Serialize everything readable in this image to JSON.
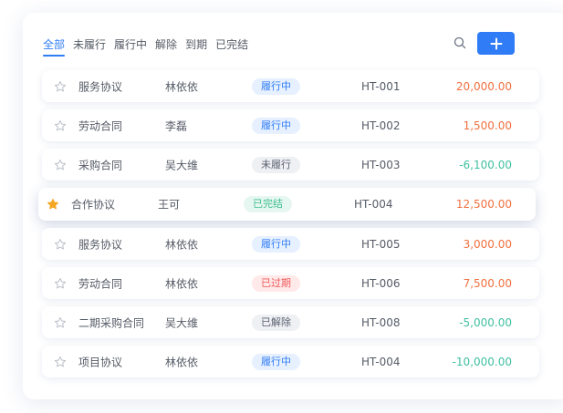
{
  "tabs": [
    {
      "label": "全部",
      "active": true
    },
    {
      "label": "未履行",
      "active": false
    },
    {
      "label": "履行中",
      "active": false
    },
    {
      "label": "解除",
      "active": false
    },
    {
      "label": "到期",
      "active": false
    },
    {
      "label": "已完结",
      "active": false
    }
  ],
  "toolbar": {
    "search_icon": "search-icon",
    "filter_icon": "filter-icon",
    "more_icon": "more-icon",
    "add_icon": "plus-icon"
  },
  "colors": {
    "accent": "#2f7cf6",
    "positive_amount": "#f0703f",
    "negative_amount": "#3fbfa1",
    "star_active": "#f5a623"
  },
  "status_styles": {
    "履行中": {
      "bg": "#e6f0ff",
      "fg": "#2f7cf6"
    },
    "未履行": {
      "bg": "#eef0f4",
      "fg": "#5a6170"
    },
    "已完结": {
      "bg": "#e6f7f1",
      "fg": "#3fbf8f"
    },
    "已过期": {
      "bg": "#ffe9e9",
      "fg": "#f05a5a"
    },
    "已解除": {
      "bg": "#eef0f4",
      "fg": "#5a6170"
    }
  },
  "rows": [
    {
      "name": "服务协议",
      "person": "林依依",
      "status": "履行中",
      "code": "HT-001",
      "amount": "20,000.00",
      "sign": "pos",
      "starred": false,
      "highlight": false
    },
    {
      "name": "劳动合同",
      "person": "李磊",
      "status": "履行中",
      "code": "HT-002",
      "amount": "1,500.00",
      "sign": "pos",
      "starred": false,
      "highlight": false
    },
    {
      "name": "采购合同",
      "person": "吴大维",
      "status": "未履行",
      "code": "HT-003",
      "amount": "-6,100.00",
      "sign": "neg",
      "starred": false,
      "highlight": false
    },
    {
      "name": "合作协议",
      "person": "王可",
      "status": "已完结",
      "code": "HT-004",
      "amount": "12,500.00",
      "sign": "pos",
      "starred": true,
      "highlight": true
    },
    {
      "name": "服务协议",
      "person": "林依依",
      "status": "履行中",
      "code": "HT-005",
      "amount": "3,000.00",
      "sign": "pos",
      "starred": false,
      "highlight": false
    },
    {
      "name": "劳动合同",
      "person": "林依依",
      "status": "已过期",
      "code": "HT-006",
      "amount": "7,500.00",
      "sign": "pos",
      "starred": false,
      "highlight": false
    },
    {
      "name": "二期采购合同",
      "person": "吴大维",
      "status": "已解除",
      "code": "HT-008",
      "amount": "-5,000.00",
      "sign": "neg",
      "starred": false,
      "highlight": false
    },
    {
      "name": "项目协议",
      "person": "林依依",
      "status": "履行中",
      "code": "HT-004",
      "amount": "-10,000.00",
      "sign": "neg",
      "starred": false,
      "highlight": false
    }
  ]
}
